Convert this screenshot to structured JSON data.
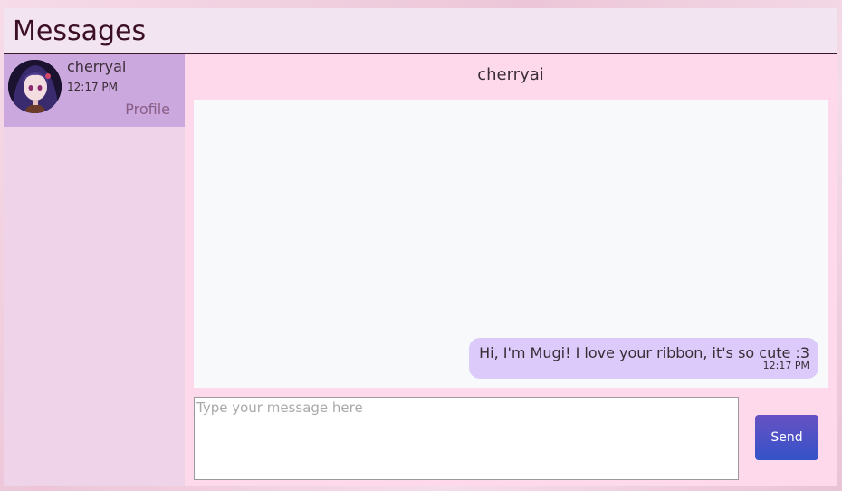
{
  "header": {
    "title": "Messages"
  },
  "sidebar": {
    "contacts": [
      {
        "name": "cherryai",
        "time": "12:17 PM",
        "profile_label": "Profile",
        "avatar": "anime-girl-avatar"
      }
    ]
  },
  "chat": {
    "title": "cherryai",
    "messages": [
      {
        "text": "Hi, I'm Mugi! I love your ribbon, it's so cute :3",
        "time": "12:17 PM",
        "direction": "outgoing"
      }
    ],
    "input": {
      "placeholder": "Type your message here",
      "value": ""
    },
    "send_label": "Send"
  },
  "colors": {
    "header_bg": "#f3e4f2",
    "sidebar_bg": "#efd3e8",
    "active_contact_bg": "#cba8de",
    "main_bg": "#fed9ec",
    "chat_bg": "#f8f9fb",
    "bubble_bg": "#dccbfa",
    "send_button": "#4a53c6"
  }
}
